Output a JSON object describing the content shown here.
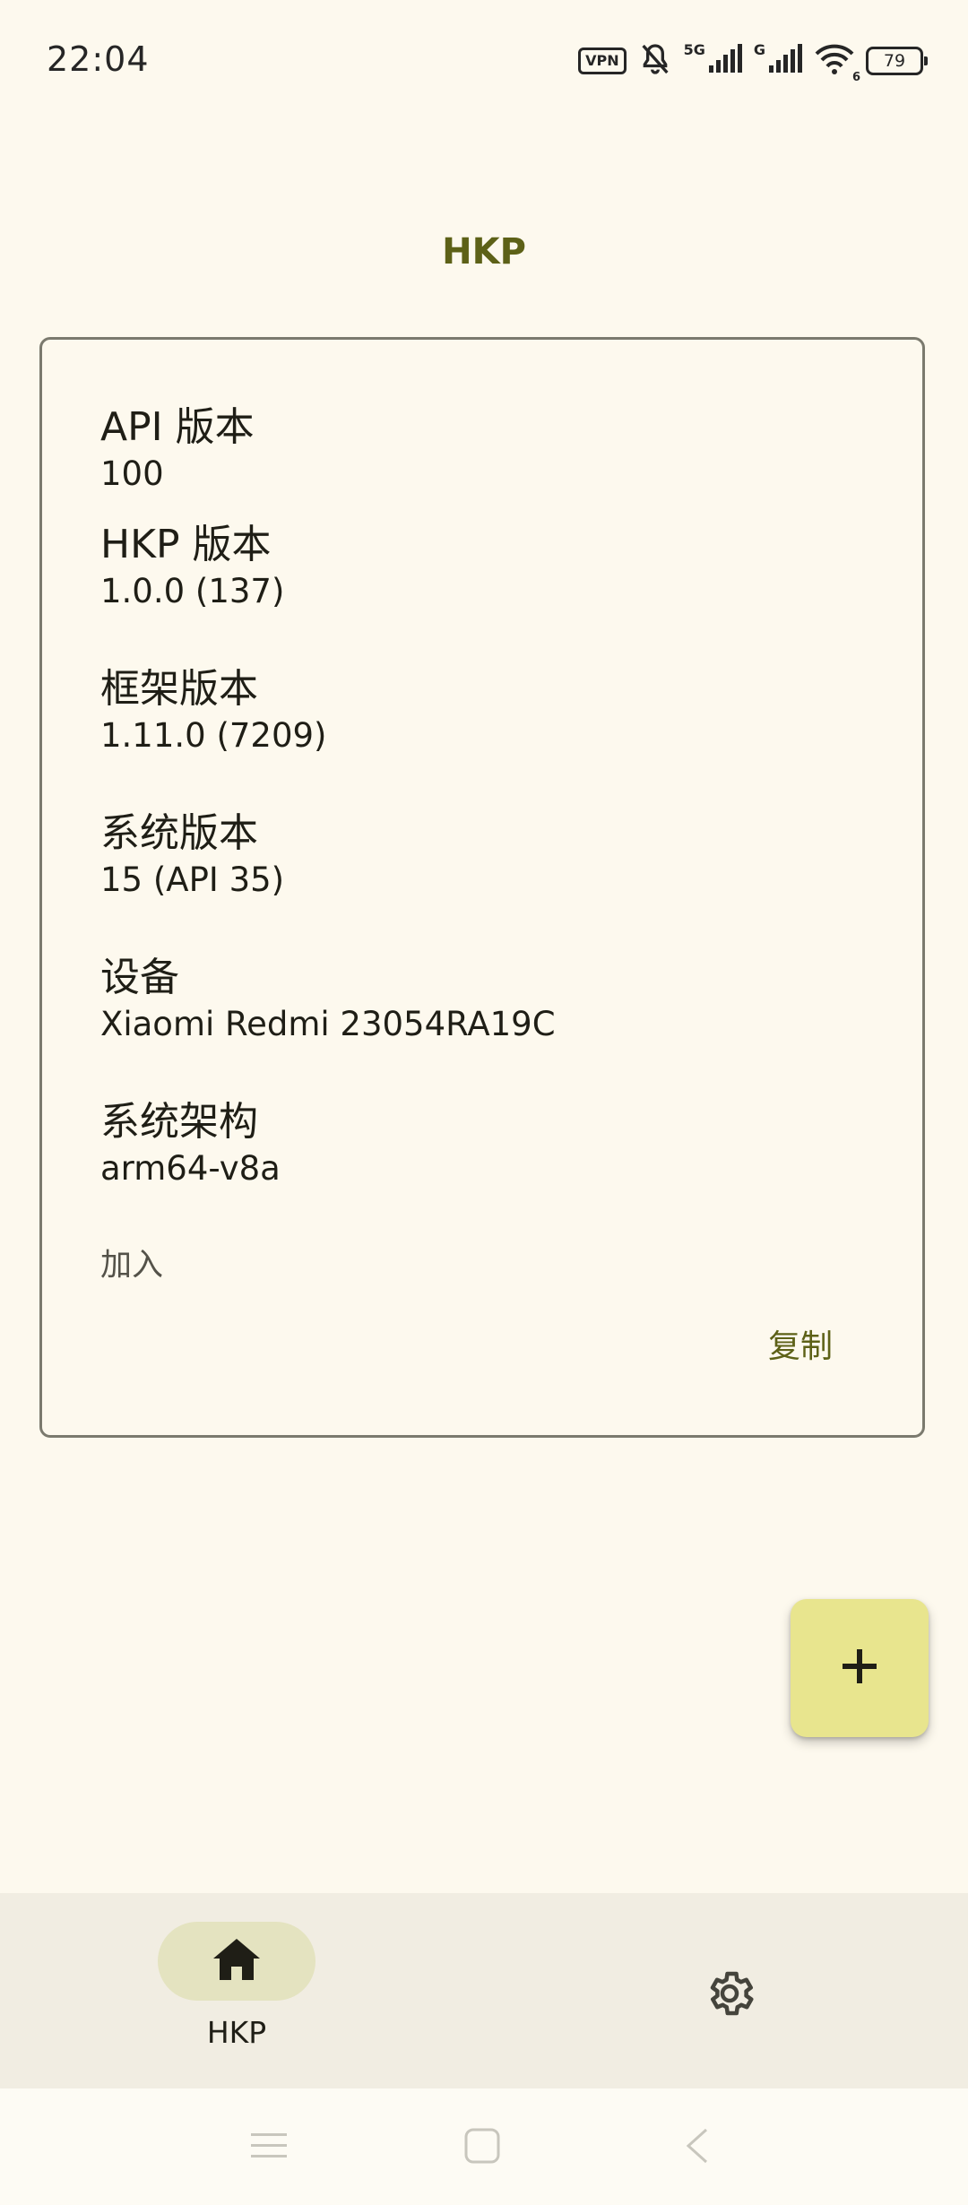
{
  "status_bar": {
    "time": "22:04",
    "vpn": "VPN",
    "sim1": "5G",
    "sim2": "G",
    "wifi_sub": "6",
    "battery": "79"
  },
  "app_title": "HKP",
  "info_card": {
    "items": [
      {
        "label": "API 版本",
        "value": "100"
      },
      {
        "label": "HKP 版本",
        "value": "1.0.0 (137)"
      },
      {
        "label": "框架版本",
        "value": "1.11.0 (7209)"
      },
      {
        "label": "系统版本",
        "value": "15 (API 35)"
      },
      {
        "label": "设备",
        "value": "Xiaomi Redmi 23054RA19C"
      },
      {
        "label": "系统架构",
        "value": "arm64-v8a"
      }
    ],
    "join_label": "加入",
    "copy_label": "复制"
  },
  "fab": {
    "icon": "plus-icon"
  },
  "bottom_nav": {
    "items": [
      {
        "label": "HKP",
        "icon": "home-icon",
        "selected": true
      },
      {
        "label": "",
        "icon": "gear-icon",
        "selected": false
      }
    ]
  },
  "system_nav": {
    "icons": [
      "menu-icon",
      "home-square-icon",
      "back-icon"
    ]
  },
  "colors": {
    "background": "#FDF9EE",
    "accent": "#5D6117",
    "fab": "#E8E58E",
    "nav_bg": "#F1EDE2",
    "nav_pill": "#E4E3C0",
    "card_border": "#7B7A6E"
  }
}
